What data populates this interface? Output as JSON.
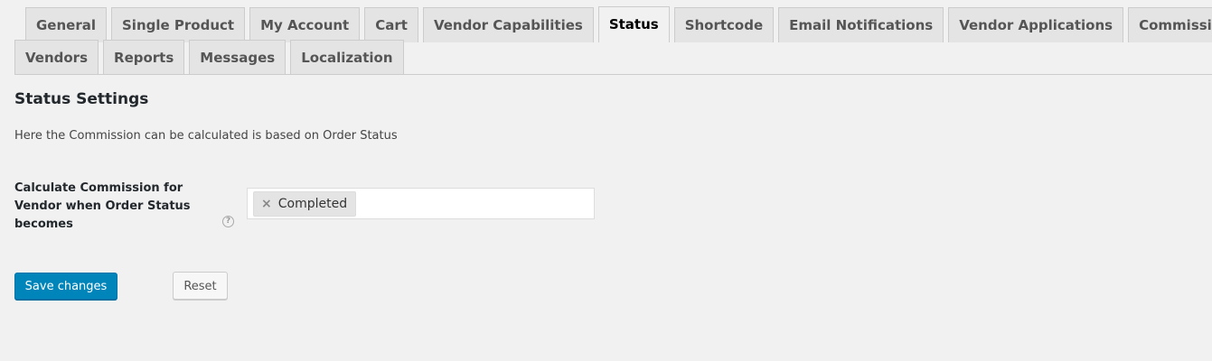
{
  "tabs": {
    "row1": [
      "General",
      "Single Product",
      "My Account",
      "Cart",
      "Vendor Capabilities",
      "Status",
      "Shortcode",
      "Email Notifications",
      "Vendor Applications",
      "Commissions"
    ],
    "row2": [
      "Vendors",
      "Reports",
      "Messages",
      "Localization"
    ],
    "active": "Status"
  },
  "section": {
    "title": "Status Settings",
    "description": "Here the Commission can be calculated is based on Order Status"
  },
  "field": {
    "label": "Calculate Commission for Vendor when Order Status becomes",
    "help_icon": "?",
    "selected": [
      "Completed"
    ],
    "remove_glyph": "×"
  },
  "buttons": {
    "save": "Save changes",
    "reset": "Reset"
  },
  "colors": {
    "primary": "#0085ba",
    "background": "#f1f1f1"
  }
}
